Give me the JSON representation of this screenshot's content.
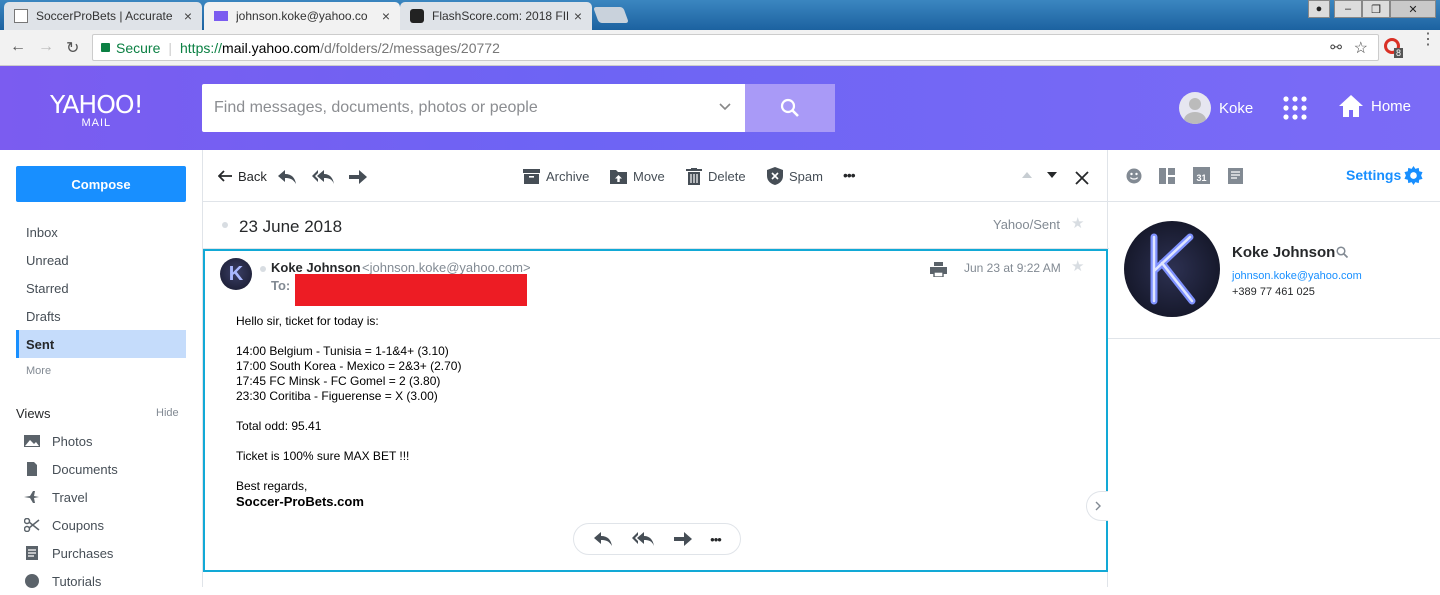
{
  "browser": {
    "tabs": [
      {
        "title": "SoccerProBets | Accurate",
        "close": "×"
      },
      {
        "title": "johnson.koke@yahoo.co",
        "close": "×"
      },
      {
        "title": "FlashScore.com: 2018 FIF",
        "close": "×"
      }
    ],
    "secure_label": "Secure",
    "url_prefix": "https://",
    "url_host": "mail.yahoo.com",
    "url_path": "/d/folders/2/messages/20772",
    "ext_badge": "8"
  },
  "header": {
    "logo_line1": "YAHOO!",
    "logo_line2": "MAIL",
    "search_placeholder": "Find messages, documents, photos or people",
    "user_name": "Koke",
    "home_label": "Home"
  },
  "sidebar": {
    "compose_label": "Compose",
    "folders": [
      {
        "label": "Inbox"
      },
      {
        "label": "Unread"
      },
      {
        "label": "Starred"
      },
      {
        "label": "Drafts"
      },
      {
        "label": "Sent"
      }
    ],
    "more_label": "More",
    "views_label": "Views",
    "hide_label": "Hide",
    "views": [
      {
        "label": "Photos"
      },
      {
        "label": "Documents"
      },
      {
        "label": "Travel"
      },
      {
        "label": "Coupons"
      },
      {
        "label": "Purchases"
      },
      {
        "label": "Tutorials"
      }
    ]
  },
  "toolbar": {
    "back_label": "Back",
    "archive_label": "Archive",
    "move_label": "Move",
    "delete_label": "Delete",
    "spam_label": "Spam",
    "more_label": "•••"
  },
  "message": {
    "subject": "23 June 2018",
    "folder": "Yahoo/Sent",
    "sender_initial": "K",
    "sender_name": "Koke Johnson",
    "sender_email": "<johnson.koke@yahoo.com>",
    "to_label": "To:",
    "date": "Jun 23 at 9:22 AM",
    "greeting": "Hello sir, ticket for today is:",
    "matches": [
      "14:00 Belgium - Tunisia = 1-1&4+ (3.10)",
      "17:00 South Korea - Mexico = 2&3+ (2.70)",
      "17:45 FC Minsk - FC Gomel = 2 (3.80)",
      "23:30 Coritiba - Figuerense = X (3.00)"
    ],
    "total": "Total odd: 95.41",
    "claim": "Ticket is 100% sure MAX BET !!!",
    "regards": "Best regards,",
    "signature": "Soccer-ProBets.com",
    "more_label": "•••"
  },
  "contact": {
    "settings_label": "Settings",
    "calendar_day": "31",
    "name": "Koke Johnson",
    "email": "johnson.koke@yahoo.com",
    "phone": "+389 77 461 025"
  },
  "colors": {
    "header_bg": "#7059f3",
    "compose": "#188fff",
    "selected_folder": "#c5dcfb",
    "message_border": "#12a9d6",
    "redaction": "#ed1c24"
  }
}
